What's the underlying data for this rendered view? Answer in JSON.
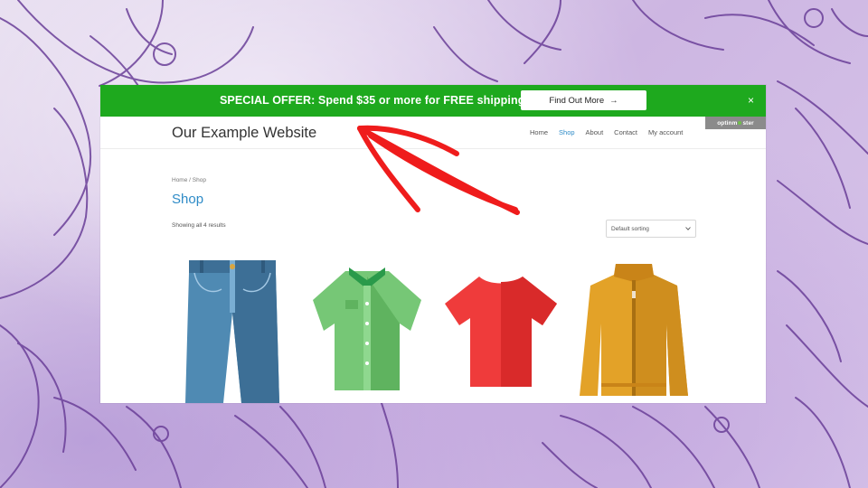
{
  "offer_bar": {
    "text": "SPECIAL OFFER: Spend $35 or more for FREE shipping",
    "button_label": "Find Out More",
    "button_arrow": "→",
    "close_symbol": "×",
    "bg_color": "#1ea91e"
  },
  "badge": {
    "text_left": "optinm",
    "text_right": "ster"
  },
  "header": {
    "site_title": "Our Example Website",
    "nav": [
      "Home",
      "Shop",
      "About",
      "Contact",
      "My account"
    ],
    "active_nav": "Shop"
  },
  "shop": {
    "breadcrumb": "Home / Shop",
    "title": "Shop",
    "result_count": "Showing all 4 results",
    "sort_selected": "Default sorting"
  },
  "products": [
    {
      "icon": "jeans-icon"
    },
    {
      "icon": "shirt-icon"
    },
    {
      "icon": "tshirt-icon"
    },
    {
      "icon": "jacket-icon"
    }
  ],
  "colors": {
    "link_blue": "#2e8bc7",
    "arrow_red": "#ef1c1c"
  }
}
